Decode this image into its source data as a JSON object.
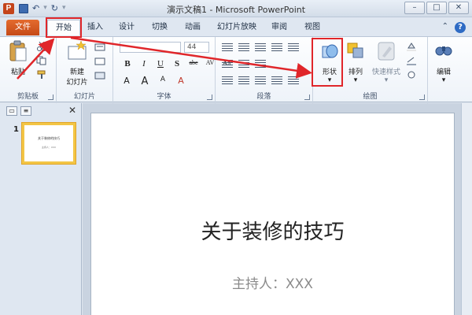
{
  "window": {
    "title": "演示文稿1 - Microsoft PowerPoint",
    "app_icon_letter": "P"
  },
  "window_controls": {
    "minimize": "–",
    "maximize": "□",
    "close": "✕"
  },
  "tabs": {
    "file": "文件",
    "items": [
      "开始",
      "插入",
      "设计",
      "切换",
      "动画",
      "幻灯片放映",
      "审阅",
      "视图"
    ],
    "active": "开始"
  },
  "ribbon": {
    "clipboard": {
      "paste_label": "粘贴",
      "group_label": "剪贴板"
    },
    "slides": {
      "new_slide_label": "新建",
      "new_slide_label2": "幻灯片",
      "group_label": "幻灯片"
    },
    "font": {
      "size_value": "44",
      "group_label": "字体",
      "row1": [
        "B",
        "I",
        "U",
        "S",
        "abc",
        "AV",
        "Aa"
      ],
      "row2": [
        "A",
        "A",
        "A",
        "A"
      ]
    },
    "paragraph": {
      "group_label": "段落"
    },
    "drawing": {
      "shapes_label": "形状",
      "arrange_label": "排列",
      "quick_styles_label": "快速样式",
      "group_label": "绘图"
    },
    "editing": {
      "label": "编辑"
    }
  },
  "slide_panel": {
    "slide_number": "1",
    "thumb_title": "关于装修的技巧",
    "thumb_subtitle": "主持人：XXX"
  },
  "slide": {
    "title": "关于装修的技巧",
    "subtitle": "主持人：XXX"
  },
  "annotations": {
    "highlight_color": "#e0262a"
  }
}
